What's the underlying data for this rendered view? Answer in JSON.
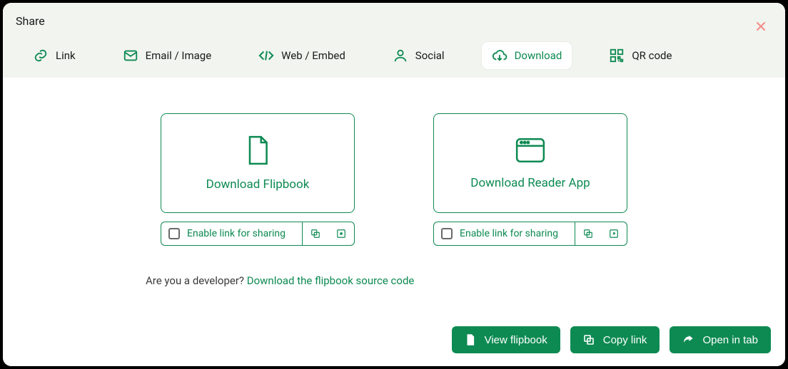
{
  "title": "Share",
  "tabs": {
    "link": "Link",
    "email": "Email / Image",
    "web": "Web / Embed",
    "social": "Social",
    "download": "Download",
    "qr": "QR code"
  },
  "cards": {
    "flipbook": {
      "label": "Download Flipbook",
      "enable_label": "Enable link for sharing"
    },
    "reader": {
      "label": "Download Reader App",
      "enable_label": "Enable link for sharing"
    }
  },
  "dev": {
    "prefix": "Are you a developer? ",
    "link": "Download the flipbook source code"
  },
  "footer": {
    "view": "View flipbook",
    "copy": "Copy link",
    "open": "Open in tab"
  }
}
